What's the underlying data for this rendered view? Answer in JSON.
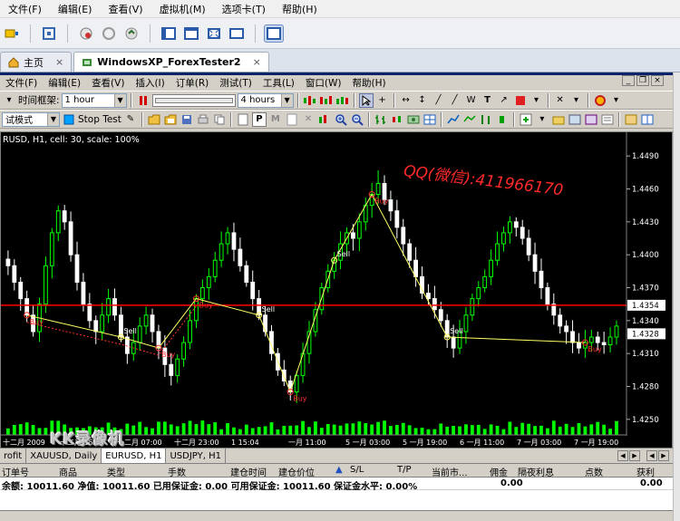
{
  "host_menu": [
    "文件(F)",
    "编辑(E)",
    "查看(V)",
    "虚拟机(M)",
    "选项卡(T)",
    "帮助(H)"
  ],
  "host_tabs": [
    {
      "label": "主页",
      "active": false
    },
    {
      "label": "WindowsXP_ForexTester2",
      "active": true
    }
  ],
  "app_menu": [
    "文件(F)",
    "编辑(E)",
    "查看(V)",
    "插入(I)",
    "订单(R)",
    "测试(T)",
    "工具(L)",
    "窗口(W)",
    "帮助(H)"
  ],
  "toolbar1": {
    "timeframe_label": "时间框架:",
    "timeframe_value": "1 hour",
    "step_value": "4 hours"
  },
  "toolbar2": {
    "mode_value": "试模式",
    "stop_test": "Stop Test"
  },
  "chart": {
    "header": "RUSD, H1, cell: 30, scale: 100%",
    "watermark_text": "QQ(微信):411966170",
    "current_price": "1.4354",
    "price_marker": "1.4328",
    "colors": {
      "bg": "#000000",
      "bull": "#00ff00",
      "bear": "#ffffff",
      "volume": "#00ff00",
      "line": "#ffff66",
      "hline": "#ff0000",
      "red_annot": "#ff3030"
    }
  },
  "chart_data": {
    "type": "candlestick",
    "symbol": "EURUSD",
    "timeframe": "H1",
    "y_ticks": [
      "1.4490",
      "1.4460",
      "1.4430",
      "1.4400",
      "1.4370",
      "1.4340",
      "1.4310",
      "1.4280",
      "1.4250"
    ],
    "x_ticks": [
      "十二月 2009",
      "十二月 15:00",
      "十二月 07:00",
      "十二月 23:00",
      "1 15:04",
      "一月 11:00",
      "5 一月 03:00",
      "5 一月 19:00",
      "6 一月 11:00",
      "7 一月 03:00",
      "7 一月 19:00"
    ],
    "ylim": [
      1.4235,
      1.4505
    ],
    "closes": [
      1.439,
      1.4375,
      1.436,
      1.4345,
      1.433,
      1.4355,
      1.439,
      1.442,
      1.444,
      1.443,
      1.44,
      1.4375,
      1.4355,
      1.434,
      1.433,
      1.4345,
      1.436,
      1.4345,
      1.4325,
      1.431,
      1.432,
      1.4335,
      1.4345,
      1.433,
      1.4315,
      1.43,
      1.429,
      1.4305,
      1.432,
      1.434,
      1.436,
      1.437,
      1.438,
      1.4395,
      1.441,
      1.442,
      1.4405,
      1.439,
      1.4375,
      1.436,
      1.4345,
      1.433,
      1.431,
      1.4295,
      1.4285,
      1.4275,
      1.429,
      1.431,
      1.433,
      1.435,
      1.437,
      1.4385,
      1.4395,
      1.441,
      1.442,
      1.4415,
      1.443,
      1.4445,
      1.4455,
      1.4465,
      1.445,
      1.444,
      1.4425,
      1.441,
      1.4395,
      1.438,
      1.4365,
      1.436,
      1.435,
      1.434,
      1.4325,
      1.4315,
      1.433,
      1.4345,
      1.436,
      1.437,
      1.438,
      1.4395,
      1.441,
      1.442,
      1.443,
      1.4425,
      1.4415,
      1.44,
      1.4385,
      1.437,
      1.4355,
      1.4345,
      1.4335,
      1.433,
      1.432,
      1.4315,
      1.432,
      1.4325,
      1.432,
      1.4318,
      1.4325,
      1.4335
    ],
    "trades": [
      {
        "label": "Buy",
        "kind": "buy"
      },
      {
        "label": "Sell",
        "kind": "sell"
      },
      {
        "label": "Buy",
        "kind": "buy"
      },
      {
        "label": "Buy",
        "kind": "buy"
      },
      {
        "label": "Sell",
        "kind": "sell"
      },
      {
        "label": "Buy",
        "kind": "buy"
      },
      {
        "label": "Sell",
        "kind": "sell"
      },
      {
        "label": "Buy",
        "kind": "buy"
      },
      {
        "label": "Sell",
        "kind": "sell"
      },
      {
        "label": "Buy",
        "kind": "buy"
      }
    ]
  },
  "chart_tabs": [
    "rofit",
    "XAUUSD, Daily",
    "EURUSD, H1",
    "USDJPY, H1"
  ],
  "active_chart_tab": 2,
  "orders_columns": [
    "订单号",
    "商品",
    "类型",
    "手数",
    "建仓时间",
    "建仓价位",
    "▲",
    "S/L",
    "T/P",
    "当前市...",
    "佣金",
    "隔夜利息",
    "点数",
    "获利"
  ],
  "orders_summary": {
    "text": "余额: 10011.60 净值: 10011.60 已用保证金: 0.00 可用保证金: 10011.60 保证金水平: 0.00%",
    "left_value": "0.00",
    "right_value": "0.00"
  },
  "watermark": "KK录像机"
}
